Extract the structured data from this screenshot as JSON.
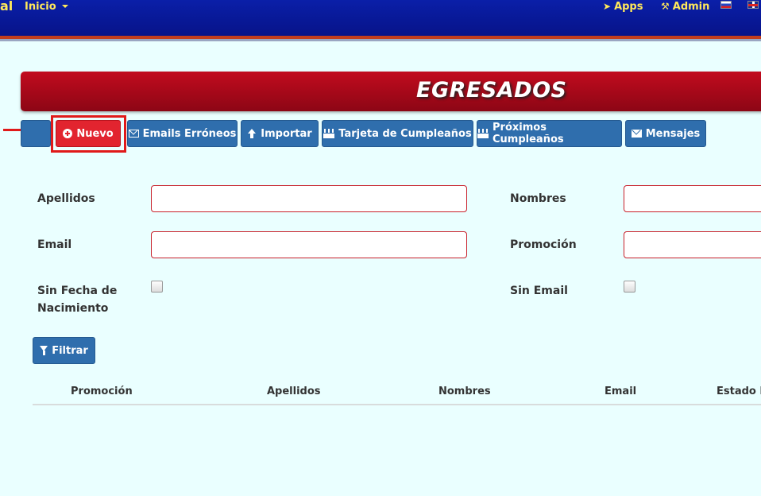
{
  "navbar": {
    "brand": "al",
    "menu_inicio": "Inicio",
    "apps": "Apps",
    "admin": "Admin"
  },
  "banner": {
    "title": "EGRESADOS"
  },
  "toolbar": {
    "nuevo": "Nuevo",
    "emails_erroneos": "Emails Erróneos",
    "importar": "Importar",
    "tarjeta_cumpleanos": "Tarjeta de Cumpleaños",
    "proximos_cumpleanos": "Próximos Cumpleaños",
    "mensajes": "Mensajes"
  },
  "filters": {
    "apellidos": "Apellidos",
    "nombres": "Nombres",
    "email": "Email",
    "promocion": "Promoción",
    "sin_fecha_line1": "Sin Fecha de",
    "sin_fecha_line2": "Nacimiento",
    "sin_email": "Sin Email",
    "filtrar": "Filtrar"
  },
  "table": {
    "columns": [
      "Promoción",
      "Apellidos",
      "Nombres",
      "Email",
      "Estado E"
    ]
  },
  "colors": {
    "navbar": "#0a1fa8",
    "nav_text": "#ffe95a",
    "banner": "#b00a1b",
    "primary_button": "#2f6ead",
    "danger_button": "#e2242f",
    "background": "#eaffff"
  }
}
